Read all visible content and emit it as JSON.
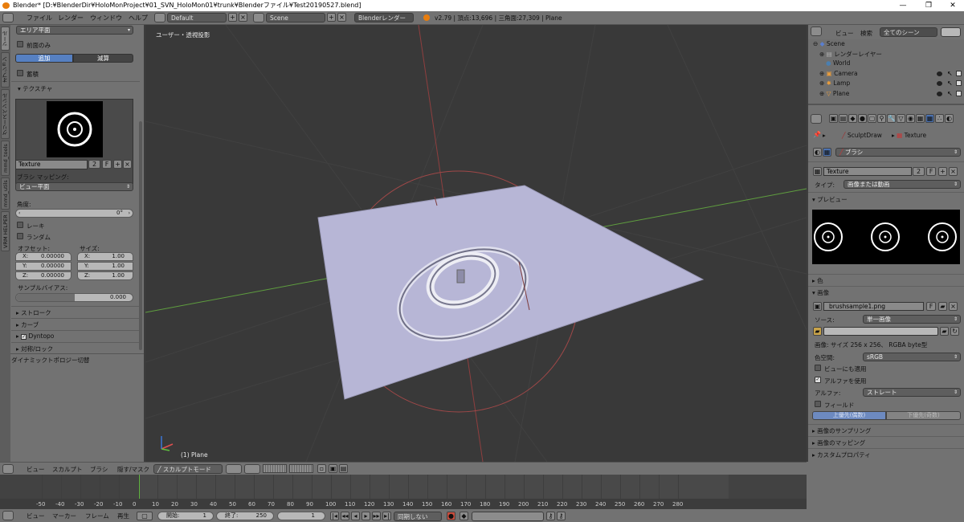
{
  "window": {
    "title": "Blender* [D:¥BlenderDir¥HoloMonProject¥01_SVN_HoloMon01¥trunk¥Blenderファイル¥Test20190527.blend]",
    "minimize": "—",
    "maximize": "❐",
    "close": "✕"
  },
  "menu": [
    "ファイル",
    "レンダー",
    "ウィンドウ",
    "ヘルプ"
  ],
  "top": {
    "screen_layout": "Default",
    "scene": "Scene",
    "engine": "Blenderレンダー",
    "stats": "v2.79 | 頂点:13,696 | 三角面:27,309 | Plane"
  },
  "left_tabs": [
    "ツール",
    "オプション",
    "グリースペンシル",
    "mmd_tools",
    "mmd_utils",
    "VRM HELPER"
  ],
  "left": {
    "area_plane": "エリア平面",
    "front_only": "前面のみ",
    "add": "追加",
    "subtract": "減算",
    "accumulate": "蓄積",
    "texture_section": "テクスチャ",
    "texture_name": "Texture",
    "texture_users": "2",
    "texture_fake": "F",
    "brush_mapping_label": "ブラシ マッピング:",
    "brush_mapping": "ビュー平面",
    "angle_label": "角度:",
    "angle_value": "0°",
    "rake": "レーキ",
    "random": "ランダム",
    "offset_label": "オフセット:",
    "size_label": "サイズ:",
    "offset": {
      "x": "X:",
      "xv": "0.00000",
      "y": "Y:",
      "yv": "0.00000",
      "z": "Z:",
      "zv": "0.00000"
    },
    "size": {
      "x": "X:",
      "xv": "1.00",
      "y": "Y:",
      "yv": "1.00",
      "z": "Z:",
      "zv": "1.00"
    },
    "sample_bias_label": "サンプルバイアス:",
    "sample_bias_value": "0.000",
    "stroke": "ストローク",
    "curve": "カーブ",
    "dyntopo": "Dyntopo",
    "symmetry": "対称/ロック",
    "dyntopo_toggle": "ダイナミックトポロジー切替"
  },
  "viewport": {
    "label": "ユーザー・透視投影",
    "object_label": "(1) Plane"
  },
  "outliner": {
    "view": "ビュー",
    "search": "検索",
    "filter": "全てのシーン",
    "items": [
      "Scene",
      "レンダーレイヤー",
      "World",
      "Camera",
      "Lamp",
      "Plane"
    ]
  },
  "props": {
    "breadcrumb_brush": "SculptDraw",
    "breadcrumb_tex": "Texture",
    "brush": "ブラシ",
    "texture_name": "Texture",
    "texture_users": "2",
    "texture_fake": "F",
    "type_label": "タイプ:",
    "type_value": "画像または動画",
    "preview": "プレビュー",
    "color": "色",
    "image": "画像",
    "image_file": "brushsample1.png",
    "image_fake": "F",
    "source_label": "ソース:",
    "source_value": "単一画像",
    "image_info": "画像: サイズ 256 x 256、 RGBA byte型",
    "color_space_label": "色空間:",
    "color_space_value": "sRGB",
    "view_as_render": "ビューにも適用",
    "use_alpha": "アルファを使用",
    "alpha_label": "アルファ:",
    "alpha_value": "ストレート",
    "fields": "フィールド",
    "upper_first": "上優先(偶数)",
    "lower_first": "下優先(奇数)",
    "image_sampling": "画像のサンプリング",
    "image_mapping": "画像のマッピング",
    "custom_props": "カスタムプロパティ"
  },
  "vpheader": {
    "view": "ビュー",
    "sculpt": "スカルプト",
    "brush": "ブラシ",
    "hide_mask": "隠す/マスク",
    "mode": "スカルプトモード"
  },
  "timeline": {
    "ticks": [
      "-50",
      "-40",
      "-30",
      "-20",
      "-10",
      "0",
      "10",
      "20",
      "30",
      "40",
      "50",
      "60",
      "70",
      "80",
      "90",
      "100",
      "110",
      "120",
      "130",
      "140",
      "150",
      "160",
      "170",
      "180",
      "190",
      "200",
      "210",
      "220",
      "230",
      "240",
      "250",
      "260",
      "270",
      "280"
    ],
    "current_frame_marker": 1
  },
  "tlheader": {
    "view": "ビュー",
    "marker": "マーカー",
    "frame": "フレーム",
    "playback": "再生",
    "start_label": "開始:",
    "start": "1",
    "end_label": "終了:",
    "end": "250",
    "current": "1",
    "sync": "同期しない"
  }
}
